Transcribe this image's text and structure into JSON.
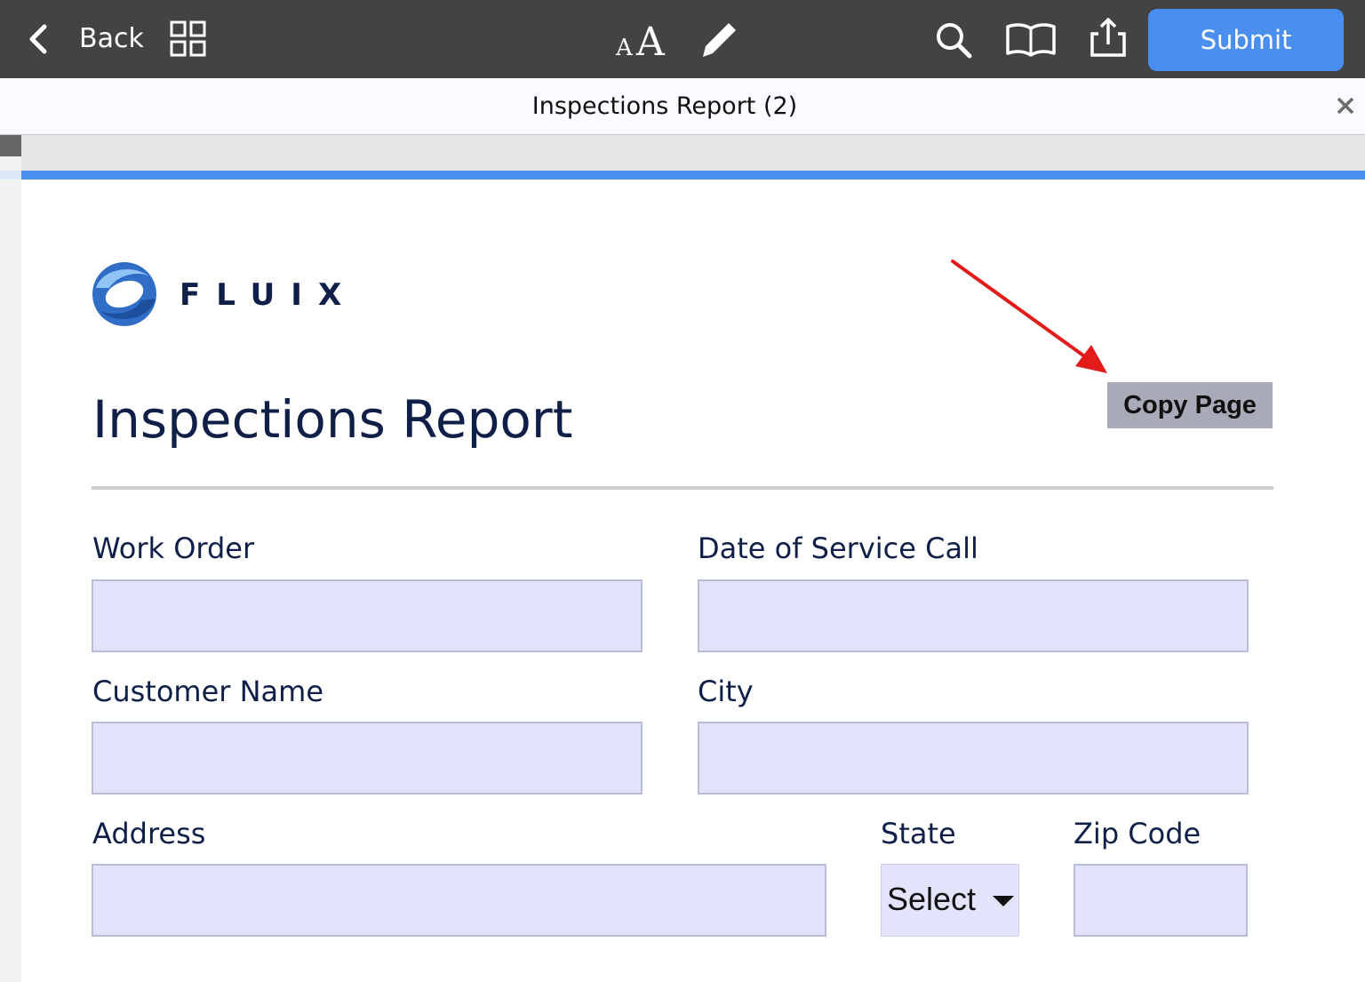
{
  "toolbar": {
    "back_label": "Back",
    "submit_label": "Submit",
    "icons": [
      "chevron-left-icon",
      "grid-icon",
      "text-size-icon",
      "pen-icon",
      "search-icon",
      "book-icon",
      "share-icon"
    ],
    "background_color": "#424345",
    "accent_color": "#4a8ff0"
  },
  "document": {
    "tab_title": "Inspections Report (2)"
  },
  "form": {
    "logo_text": "FLUIX",
    "title": "Inspections Report",
    "copy_page_label": "Copy Page",
    "fields": {
      "work_order": {
        "label": "Work Order",
        "value": ""
      },
      "date_of_service_call": {
        "label": "Date of Service Call",
        "value": ""
      },
      "customer_name": {
        "label": "Customer Name",
        "value": ""
      },
      "city": {
        "label": "City",
        "value": ""
      },
      "address": {
        "label": "Address",
        "value": ""
      },
      "state": {
        "label": "State",
        "selected": "Select"
      },
      "zip_code": {
        "label": "Zip Code",
        "value": ""
      }
    },
    "field_background": "#e3e4fb",
    "label_color": "#0f1f48"
  }
}
